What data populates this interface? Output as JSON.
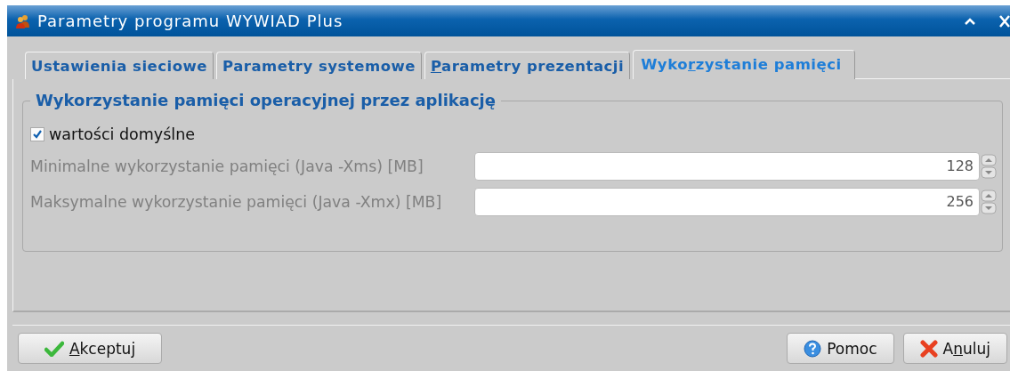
{
  "window": {
    "title": "Parametry programu WYWIAD Plus"
  },
  "tabs": [
    {
      "pre": "Ustawienia sieciowe",
      "selected": false
    },
    {
      "pre": "Parametry systemowe",
      "selected": false
    },
    {
      "key": "P",
      "post": "arametry prezentacji",
      "selected": false
    },
    {
      "pre": "Wyko",
      "key": "r",
      "post": "zystanie pamięci",
      "selected": true
    }
  ],
  "group": {
    "title": "Wykorzystanie pamięci operacyjnej przez aplikację",
    "checkbox": {
      "label": "wartości domyślne",
      "checked": true
    },
    "fields": [
      {
        "label": "Minimalne wykorzystanie pamięci (Java -Xms) [MB]",
        "value": "128",
        "disabled": true
      },
      {
        "label": "Maksymalne wykorzystanie pamięci (Java -Xmx) [MB]",
        "value": "256",
        "disabled": true
      }
    ]
  },
  "buttons": [
    {
      "kind": "accept",
      "key": "A",
      "post": "kceptuj"
    },
    {
      "kind": "help",
      "pre": "Pomoc"
    },
    {
      "kind": "cancel",
      "pre": "A",
      "key": "n",
      "post": "uluj"
    }
  ]
}
